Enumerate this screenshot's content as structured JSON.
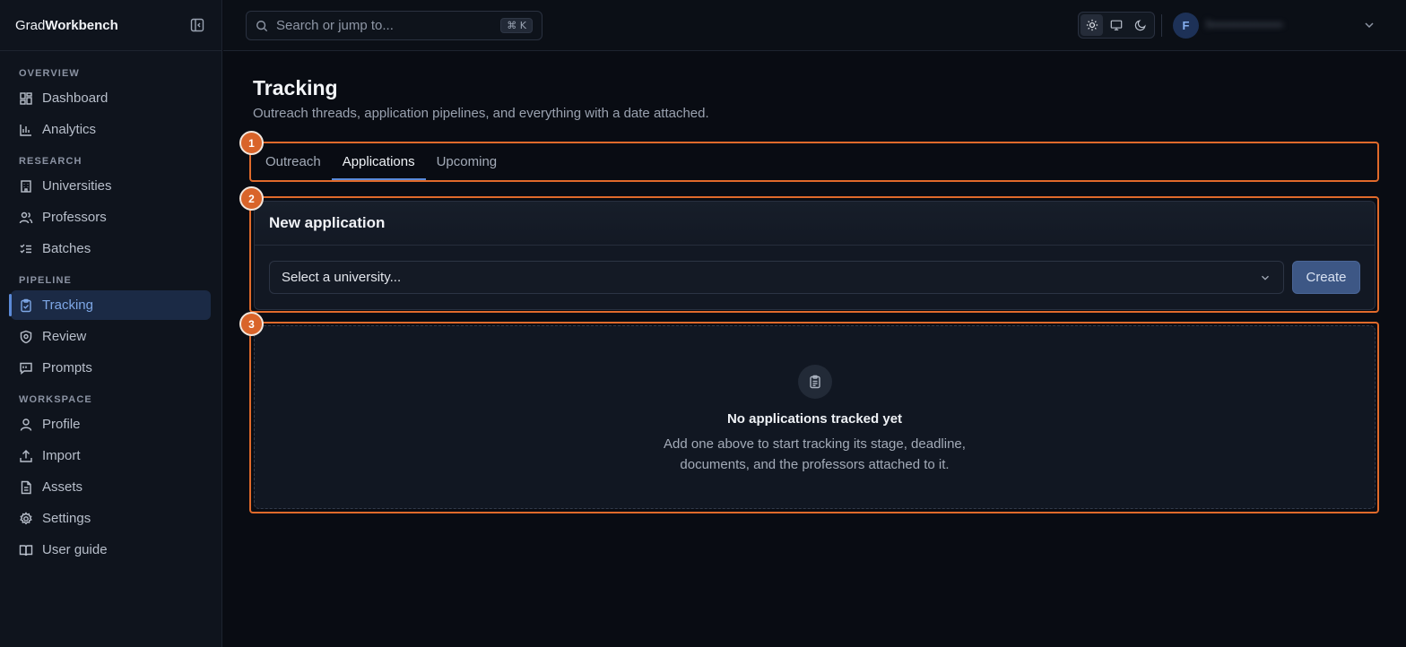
{
  "brand": {
    "prefix": "Grad",
    "bold": "Workbench"
  },
  "sidebar": {
    "sections": [
      {
        "label": "OVERVIEW",
        "items": [
          {
            "label": "Dashboard",
            "icon": "dashboard-icon"
          },
          {
            "label": "Analytics",
            "icon": "chart-icon"
          }
        ]
      },
      {
        "label": "RESEARCH",
        "items": [
          {
            "label": "Universities",
            "icon": "building-icon"
          },
          {
            "label": "Professors",
            "icon": "users-icon"
          },
          {
            "label": "Batches",
            "icon": "checklist-icon"
          }
        ]
      },
      {
        "label": "PIPELINE",
        "items": [
          {
            "label": "Tracking",
            "icon": "clipboard-icon",
            "active": true
          },
          {
            "label": "Review",
            "icon": "shield-icon"
          },
          {
            "label": "Prompts",
            "icon": "message-icon"
          }
        ]
      },
      {
        "label": "WORKSPACE",
        "items": [
          {
            "label": "Profile",
            "icon": "user-icon"
          },
          {
            "label": "Import",
            "icon": "upload-icon"
          },
          {
            "label": "Assets",
            "icon": "file-icon"
          },
          {
            "label": "Settings",
            "icon": "gear-icon"
          },
          {
            "label": "User guide",
            "icon": "book-icon"
          }
        ]
      }
    ]
  },
  "topbar": {
    "search_placeholder": "Search or jump to...",
    "shortcut": "⌘ K",
    "avatar_initial": "F",
    "username": "f••••••••••••••••••"
  },
  "page": {
    "title": "Tracking",
    "subtitle": "Outreach threads, application pipelines, and everything with a date attached."
  },
  "tabs": [
    {
      "label": "Outreach"
    },
    {
      "label": "Applications",
      "active": true
    },
    {
      "label": "Upcoming"
    }
  ],
  "new_application": {
    "title": "New application",
    "select_placeholder": "Select a university...",
    "create_label": "Create"
  },
  "empty_state": {
    "title": "No applications tracked yet",
    "description": "Add one above to start tracking its stage, deadline, documents, and the professors attached to it."
  },
  "callouts": [
    "1",
    "2",
    "3"
  ],
  "colors": {
    "accent": "#5b8ad8",
    "callout": "#e06a2b",
    "background": "#090c13"
  }
}
